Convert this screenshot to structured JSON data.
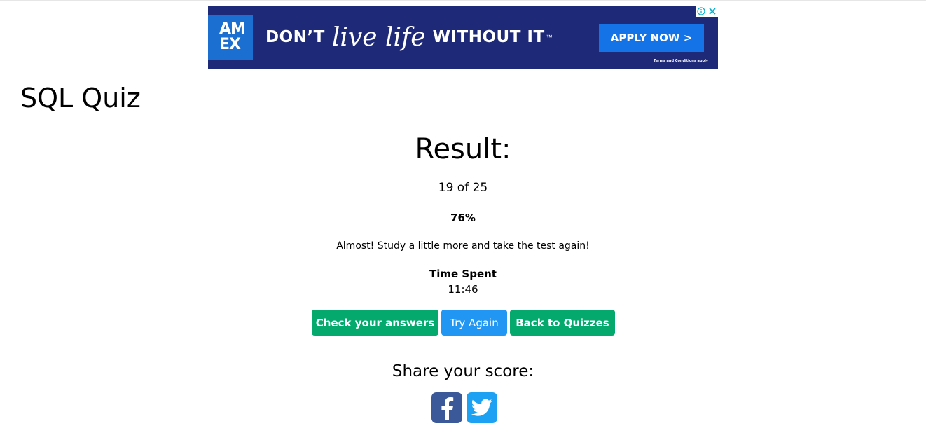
{
  "ad": {
    "logo_line1": "AM",
    "logo_line2": "EX",
    "headline_part1": "DON’T",
    "headline_script": "live life",
    "headline_part2": "WITHOUT IT",
    "trademark": "™",
    "cta_label": "APPLY NOW >",
    "terms": "Terms and Conditions apply",
    "info_icon": "info-icon",
    "close_icon": "close-icon",
    "colors": {
      "background": "#1e2a78",
      "brand_blue": "#1473e6"
    }
  },
  "page": {
    "title": "SQL Quiz"
  },
  "result": {
    "heading": "Result:",
    "score": "19 of 25",
    "percent": "76%",
    "message": "Almost! Study a little more and take the test again!",
    "time_label": "Time Spent",
    "time_value": "11:46"
  },
  "actions": {
    "check_label": "Check your answers",
    "try_again_label": "Try Again",
    "back_label": "Back to Quizzes",
    "colors": {
      "green": "#04aa6d",
      "blue": "#2196f3"
    }
  },
  "share": {
    "heading": "Share your score:",
    "icons": [
      "facebook-icon",
      "twitter-icon"
    ],
    "colors": {
      "facebook": "#3b5998",
      "twitter": "#1da1f2"
    }
  }
}
